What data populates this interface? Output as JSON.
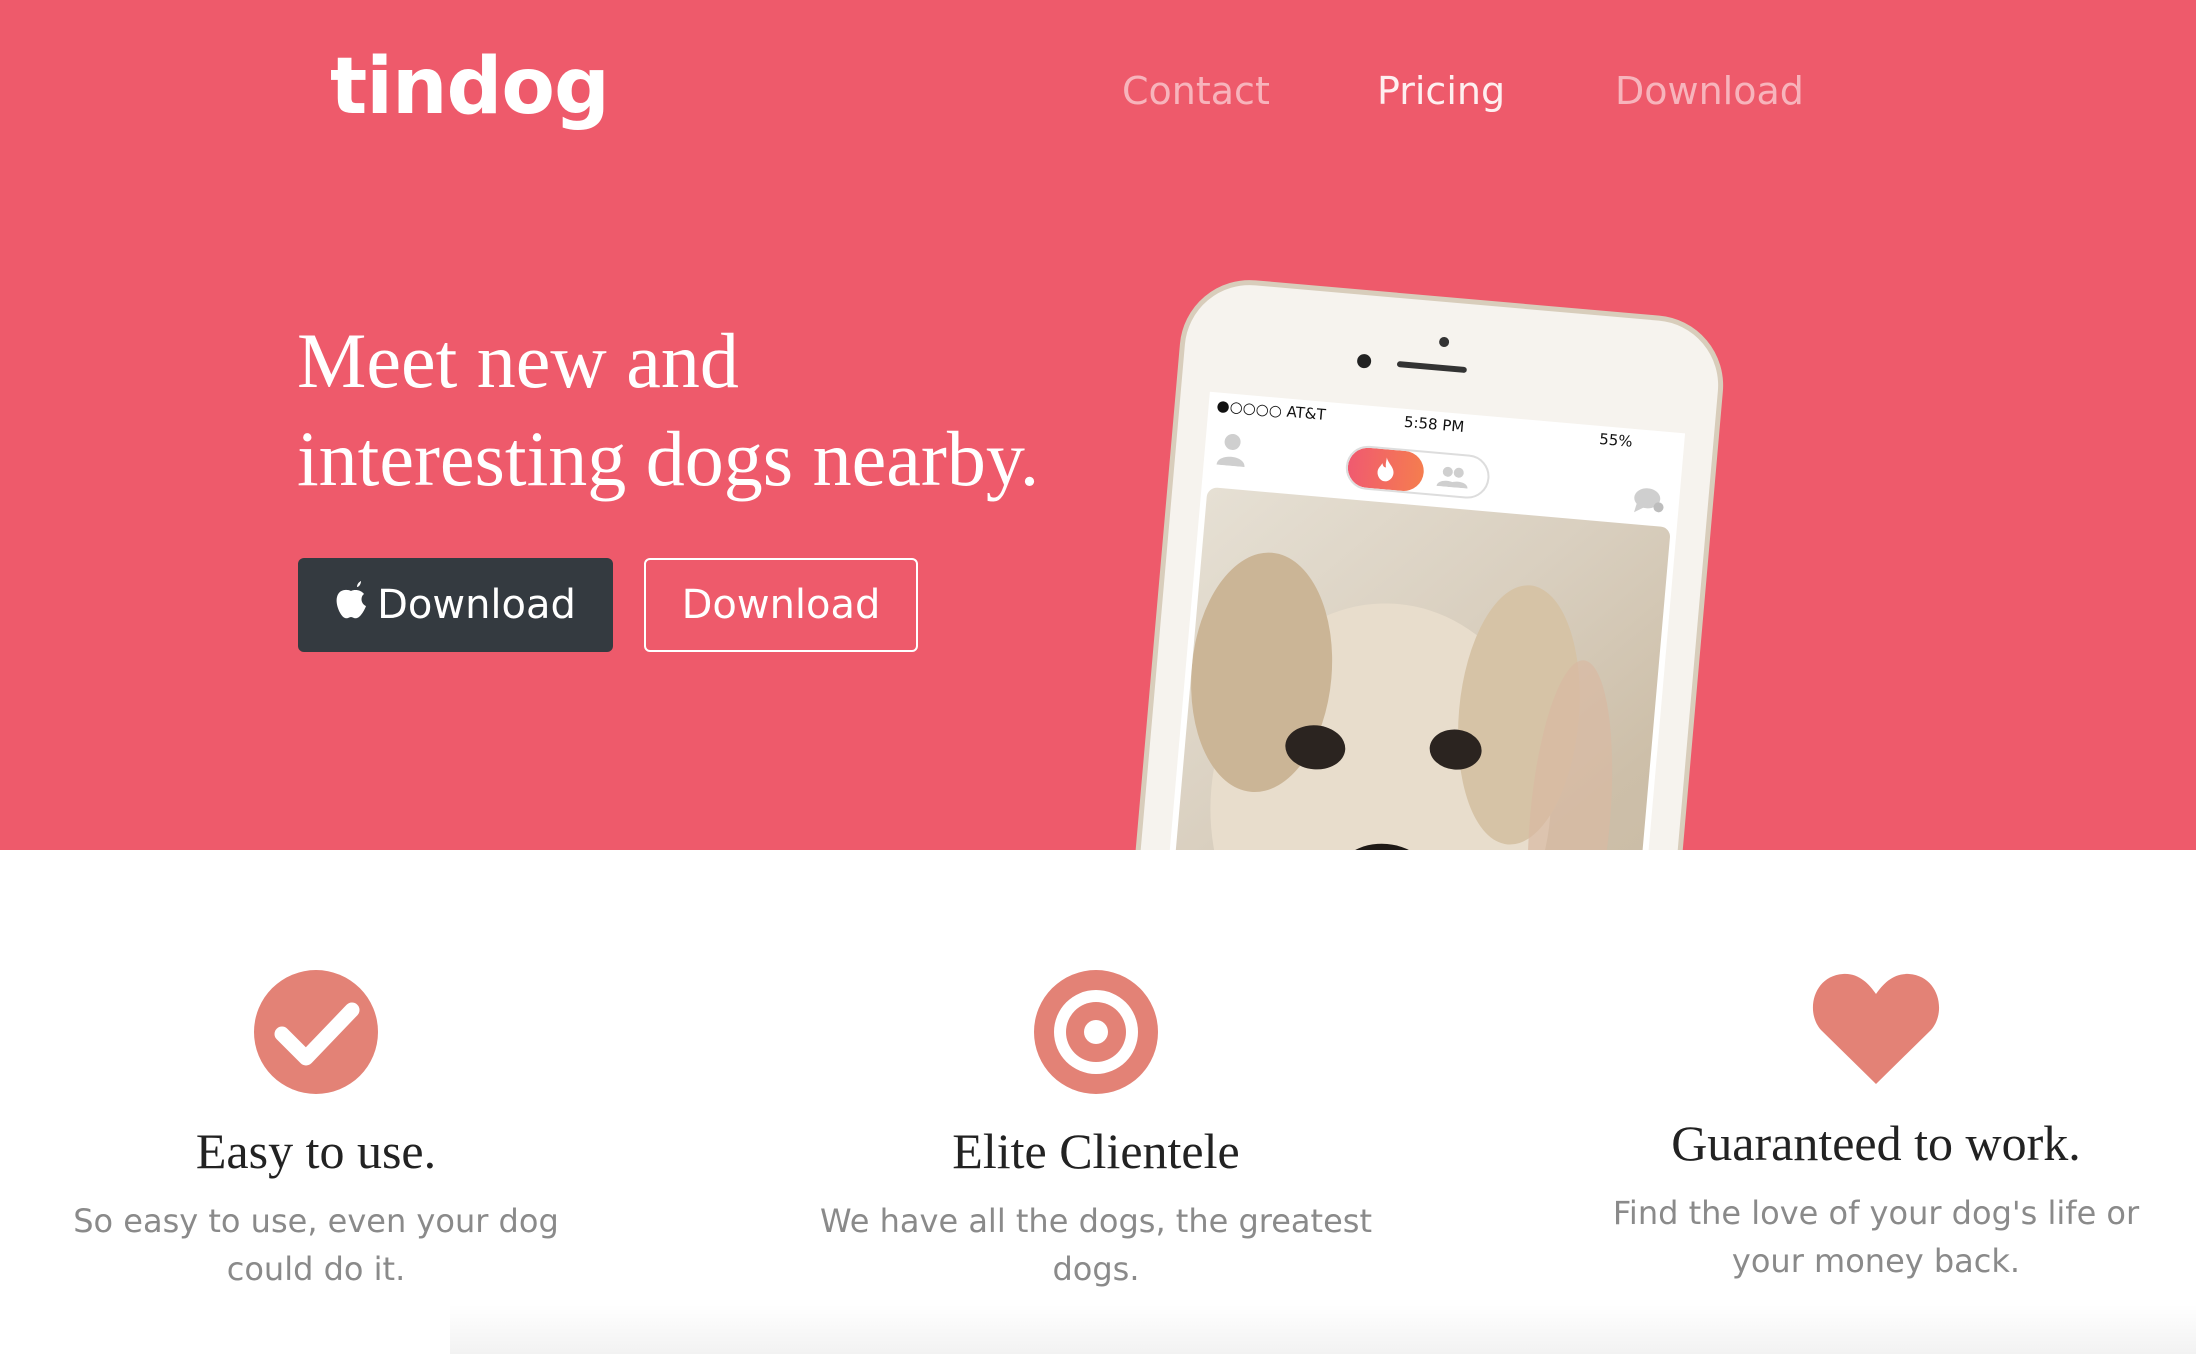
{
  "brand": {
    "name": "tindog"
  },
  "nav": {
    "items": [
      "Contact",
      "Pricing",
      "Download"
    ]
  },
  "hero": {
    "headline_line1": "Meet new and",
    "headline_line2": "interesting dogs nearby.",
    "btn_apple_label": "Download",
    "btn_google_label": "Download"
  },
  "phone": {
    "carrier": "●○○○○ AT&T",
    "time": "5:58 PM",
    "battery": "55%"
  },
  "features": [
    {
      "icon": "check-circle-icon",
      "title": "Easy to use.",
      "text_line1": "So easy to use, even your dog",
      "text_line2": "could do it."
    },
    {
      "icon": "target-icon",
      "title": "Elite Clientele",
      "text_line1": "We have all the dogs, the greatest",
      "text_line2": "dogs."
    },
    {
      "icon": "heart-icon",
      "title": "Guaranteed to work.",
      "text_line1": "Find the love of your dog's life or",
      "text_line2": "your money back."
    }
  ],
  "colors": {
    "hero_bg": "#ee5a6b",
    "icon": "#e38276",
    "dark_button": "#343a40"
  }
}
